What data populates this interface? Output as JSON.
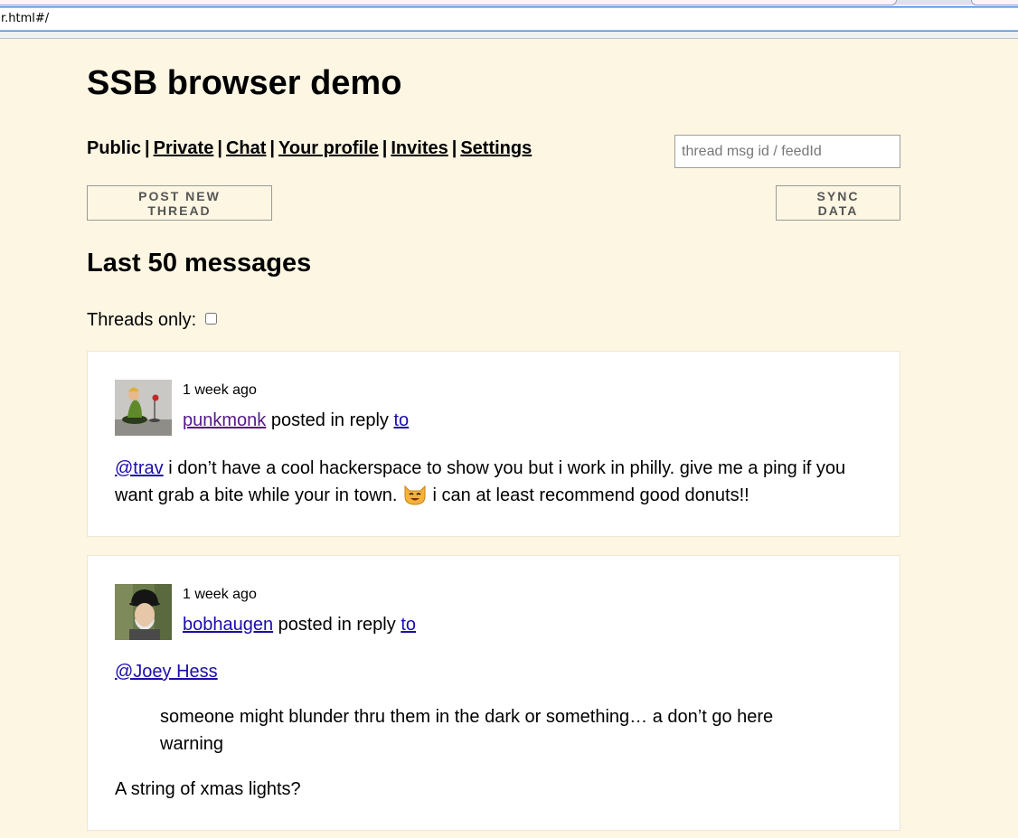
{
  "browser": {
    "url": "r.html#/"
  },
  "app": {
    "title": "SSB browser demo"
  },
  "nav": {
    "public": "Public",
    "private": "Private",
    "chat": "Chat",
    "profile": "Your profile",
    "invites": "Invites",
    "settings": "Settings",
    "separator": "|"
  },
  "search": {
    "placeholder": "thread msg id / feedId",
    "value": ""
  },
  "buttons": {
    "post_new_thread": "POST NEW THREAD",
    "sync_data": "SYNC DATA"
  },
  "section": {
    "title": "Last 50 messages",
    "threads_only_label": "Threads only:",
    "threads_only_checked": false
  },
  "messages": [
    {
      "time": "1 week ago",
      "author": "punkmonk",
      "action": "posted in reply",
      "to": "to",
      "mention": "@trav",
      "text_before_emoji": " i don’t have a cool hackerspace to show you but i work in philly. give me a ping if you want grab a bite while your in town. ",
      "emoji": "smiley-cat",
      "text_after_emoji": " i can at least recommend good donuts!!"
    },
    {
      "time": "1 week ago",
      "author": "bobhaugen",
      "action": "posted in reply",
      "to": "to",
      "mention": "@Joey Hess",
      "quote": "someone might blunder thru them in the dark or something… a don’t go here warning",
      "reply": "A string of xmas lights?"
    }
  ],
  "colors": {
    "background": "#fdf6e3",
    "card": "#ffffff",
    "link": "#1a0dab",
    "visited_link": "#551a8b"
  }
}
